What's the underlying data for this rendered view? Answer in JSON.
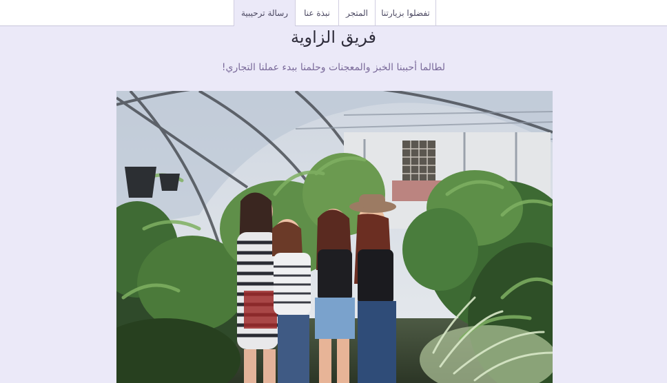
{
  "nav": {
    "tabs": [
      {
        "label": "رسالة ترحيبية",
        "active": true
      },
      {
        "label": "نبذة عنا",
        "active": false
      },
      {
        "label": "المتجر",
        "active": false
      },
      {
        "label": "تفضلوا بزيارتنا",
        "active": false
      }
    ]
  },
  "header": {
    "title": "فريق الزاوية",
    "subtitle": "لطالما أحببنا الخبز والمعجنات وحلمنا ببدء عملنا التجاري!"
  },
  "colors": {
    "page_background": "#ebe9f8",
    "title": "#2e2c3a",
    "subtitle": "#7a6a9a"
  }
}
